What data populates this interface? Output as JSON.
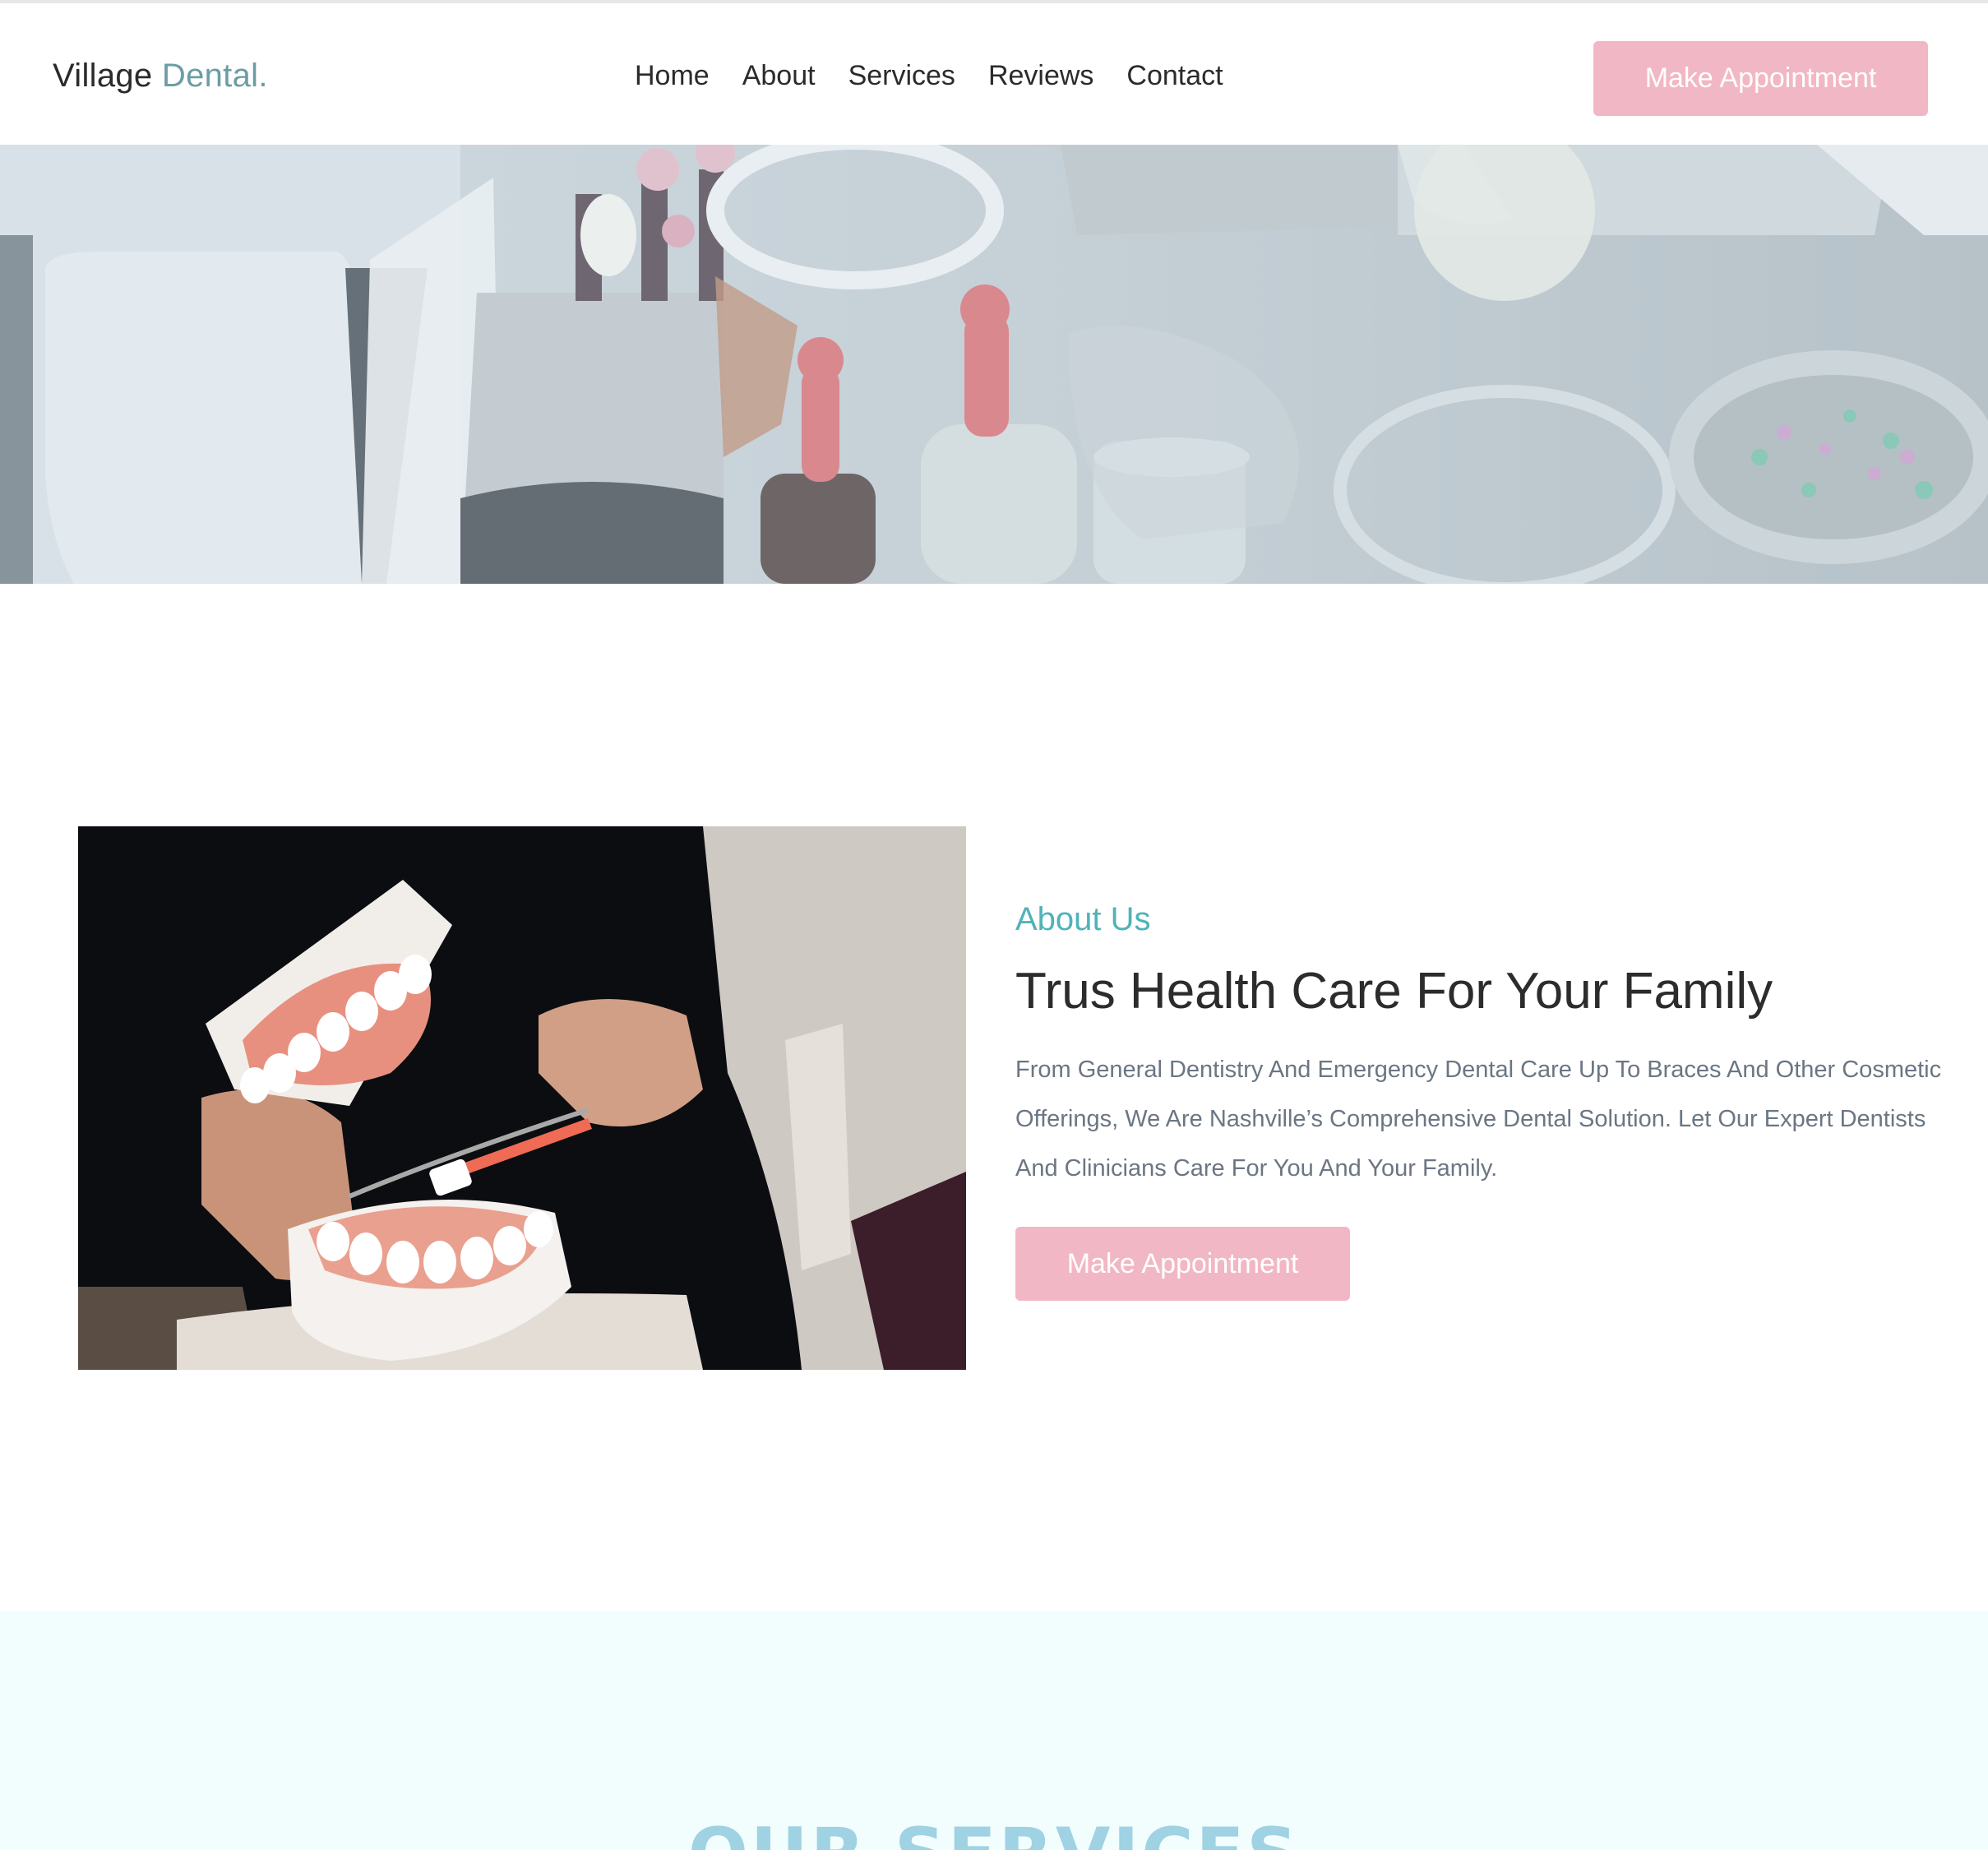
{
  "header": {
    "logo_main": "Village",
    "logo_accent": "Dental.",
    "nav": [
      "Home",
      "About",
      "Services",
      "Reviews",
      "Contact"
    ],
    "cta_label": "Make Appointment"
  },
  "about": {
    "label": "About Us",
    "title": "Trus Health Care For Your Family",
    "body": "From General Dentistry And Emergency Dental Care Up To Braces And Other Cosmetic Offerings, We Are Nashville’s Comprehensive Dental Solution. Let Our Expert Dentists And Clinicians Care For You And Your Family.",
    "cta_label": "Make Appointment"
  },
  "services": {
    "title": "OUR SERVICES"
  },
  "colors": {
    "accent_teal": "#4fb3b8",
    "logo_accent": "#6b9ea4",
    "button_pink": "#f2b7c4",
    "services_bg": "#f2fdfd",
    "services_title": "#9fd2e3"
  }
}
